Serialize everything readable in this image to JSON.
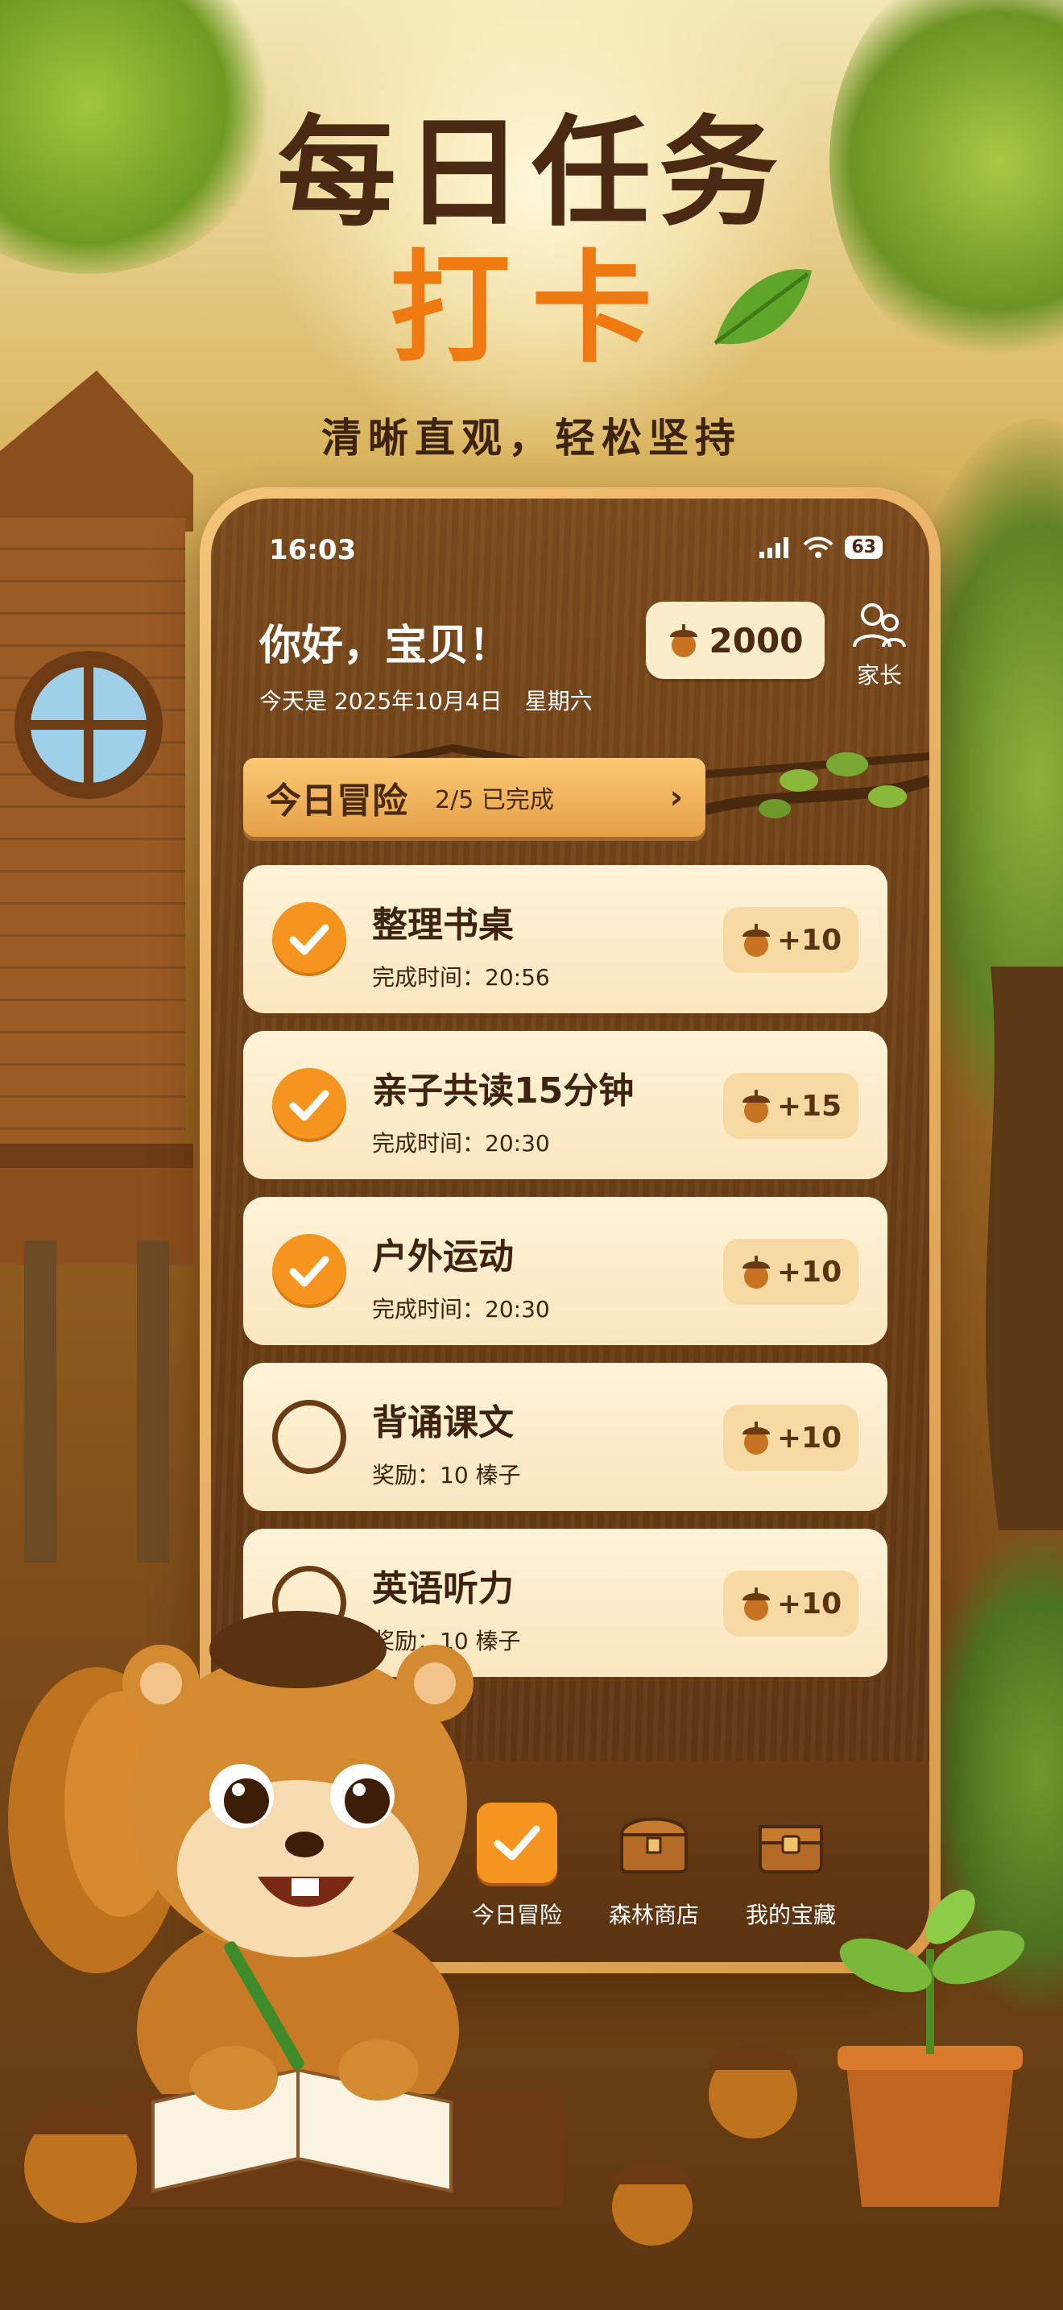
{
  "headline": {
    "line1": "每日任务",
    "line2": "打卡",
    "tagline": "清晰直观，轻松坚持"
  },
  "status_bar": {
    "time": "16:03",
    "battery": "63"
  },
  "header": {
    "greeting": "你好，宝贝！",
    "date": "今天是 2025年10月4日　星期六",
    "coins": "2000",
    "parent_label": "家长"
  },
  "banner": {
    "title": "今日冒险",
    "progress": "2/5 已完成",
    "chevron": "›"
  },
  "tasks": [
    {
      "title": "整理书桌",
      "subtitle": "完成时间：20:56",
      "reward": "+10",
      "done": true
    },
    {
      "title": "亲子共读15分钟",
      "subtitle": "完成时间：20:30",
      "reward": "+15",
      "done": true
    },
    {
      "title": "户外运动",
      "subtitle": "完成时间：20:30",
      "reward": "+10",
      "done": true
    },
    {
      "title": "背诵课文",
      "subtitle": "奖励：10 榛子",
      "reward": "+10",
      "done": false
    },
    {
      "title": "英语听力",
      "subtitle": "奖励：10 榛子",
      "reward": "+10",
      "done": false
    }
  ],
  "tabbar": [
    {
      "label": "今日冒险",
      "icon": "checkbox-icon",
      "active": true
    },
    {
      "label": "森林商店",
      "icon": "shop-chest-icon",
      "active": false
    },
    {
      "label": "我的宝藏",
      "icon": "treasure-chest-icon",
      "active": false
    }
  ],
  "colors": {
    "accent": "#f07a12",
    "wood": "#6c3f17",
    "card": "#fff3d8",
    "text_dark": "#3e2410"
  }
}
